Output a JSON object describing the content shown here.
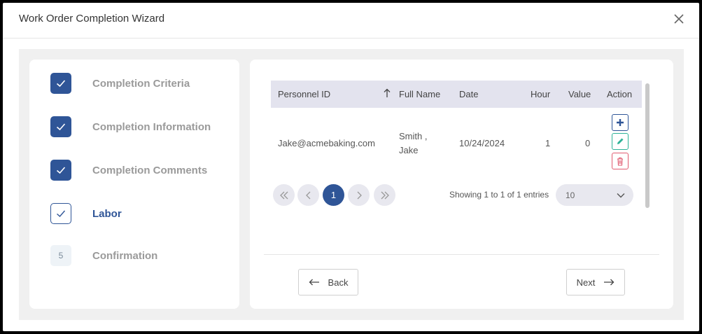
{
  "dialog": {
    "title": "Work Order Completion Wizard",
    "close_icon": "close-icon"
  },
  "steps": [
    {
      "label": "Completion Criteria",
      "state": "done"
    },
    {
      "label": "Completion Information",
      "state": "done"
    },
    {
      "label": "Completion Comments",
      "state": "done"
    },
    {
      "label": "Labor",
      "state": "current"
    },
    {
      "label": "Confirmation",
      "state": "pending",
      "number": "5"
    }
  ],
  "table": {
    "columns": {
      "personnel_id": "Personnel ID",
      "full_name": "Full Name",
      "date": "Date",
      "hour": "Hour",
      "value": "Value",
      "action": "Action"
    },
    "sort_icon": "arrow-up-icon",
    "rows": [
      {
        "personnel_id": "Jake@acmebaking.com",
        "full_name_line1": "Smith ,",
        "full_name_line2": "Jake",
        "date": "10/24/2024",
        "hour": "1",
        "value": "0"
      }
    ]
  },
  "pagination": {
    "current_page": "1",
    "entries_text": "Showing 1 to 1 of 1 entries",
    "page_size": "10"
  },
  "buttons": {
    "back": "Back",
    "next": "Next"
  },
  "colors": {
    "primary": "#2f5597",
    "edit": "#2eb398",
    "delete": "#e05a6f"
  }
}
